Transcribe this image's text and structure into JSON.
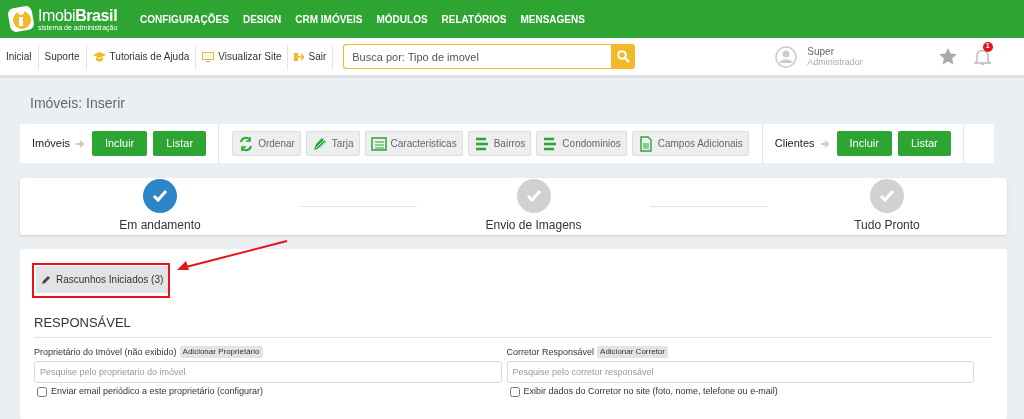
{
  "logo": {
    "name_light": "Imobi",
    "name_bold": "Brasil",
    "tagline": "sistema de administração"
  },
  "main_menu": [
    "CONFIGURAÇÕES",
    "DESIGN",
    "CRM IMÓVEIS",
    "MÓDULOS",
    "RELATÓRIOS",
    "MENSAGENS"
  ],
  "toolbar_links": [
    "Inicial",
    "Suporte",
    "Tutoriais de Ajuda",
    "Visualizar Site",
    "Sair"
  ],
  "search": {
    "placeholder": "Busca por: Tipo de imovel"
  },
  "user": {
    "name": "Super",
    "role": "Administrador"
  },
  "notifications": {
    "count": "1"
  },
  "page_title": "Imóveis: Inserir",
  "imoveis_group": {
    "label": "Imóveis",
    "buttons": [
      "Incluir",
      "Listar"
    ]
  },
  "tools": [
    "Ordenar",
    "Tarja",
    "Caracteristicas",
    "Bairros",
    "Condominios",
    "Campos Adicionais"
  ],
  "clientes_group": {
    "label": "Clientes",
    "buttons": [
      "Incluir",
      "Listar"
    ]
  },
  "steps": [
    {
      "label": "Em andamento",
      "selected": true
    },
    {
      "label": "Envio de Imagens",
      "selected": false
    },
    {
      "label": "Tudo Pronto",
      "selected": false
    }
  ],
  "drafts_button": "Rascunhos Iniciados (3)",
  "section_title": "RESPONSÁVEL",
  "fields": [
    {
      "label": "Proprietário do Imóvel (não exibido)",
      "add_button": "Adicionar Proprietário",
      "placeholder": "Pesquise pelo proprietario do imóvel",
      "checkbox": {
        "label": "Enviar email periódico a este proprietário (configurar)",
        "checked": false
      }
    },
    {
      "label": "Corretor Responsável",
      "add_button": "Adicionar Corretor",
      "placeholder": "Pesquise pelo corretor responsável",
      "checkbox": {
        "label": "Exibir dados do Corretor no site (foto, nome, telefone ou e-mail)",
        "checked": false
      }
    }
  ]
}
